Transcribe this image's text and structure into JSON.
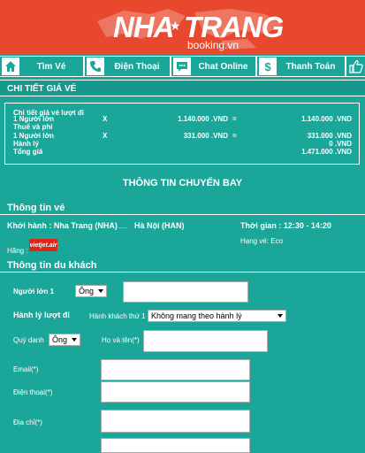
{
  "brand": {
    "part1": "NHA",
    "part2": "TRANG",
    "sub": "booking.vn"
  },
  "nav": [
    {
      "label": "Tìm Vé",
      "icon": "home-icon"
    },
    {
      "label": "Điện Thoại",
      "icon": "phone-icon"
    },
    {
      "label": "Chat Online",
      "icon": "chat-icon"
    },
    {
      "label": "Thanh Toán",
      "icon": "dollar-icon"
    }
  ],
  "price": {
    "section_title": "CHI TIẾT GIÁ VÉ",
    "label_detail": "Chi tiết giá vé lượt đi",
    "row1_label": "1 Người lớn",
    "row1_x": "X",
    "row1_price": "1.140.000 .VND",
    "row1_eq": "=",
    "row1_total": "1.140.000 .VND",
    "tax_label": "Thuế và phí",
    "row2_label": "1 Người lớn",
    "row2_x": "X",
    "row2_price": "331.000 .VND",
    "row2_eq": "=",
    "row2_total": "331.000 .VND",
    "luggage_label": "Hành lý",
    "luggage_value": "0 .VND",
    "total_label": "Tổng giá",
    "total_value": "1.471.000 .VND"
  },
  "flight": {
    "header": "THÔNG TIN CHUYẾN BAY",
    "ticket_title": "Thông tin vé",
    "depart_label": "Khởi hành : Nha Trang (NHA)",
    "arrow": "....",
    "arrive": "Hà Nội (HAN)",
    "time": "Thời gian : 12:30 - 14:20",
    "airline_label": "Hãng :",
    "airline_logo": "vietjet.air",
    "class": "Hạng vé: Eco"
  },
  "passenger": {
    "title": "Thông tin du khách",
    "adult_label": "Người lớn 1",
    "adult_title_value": "Ông",
    "luggage_label": "Hành lý lượt đi",
    "pax_label": "Hành khách thứ 1",
    "luggage_option": "Không mang theo hành lý",
    "contact_title_label": "Quý danh",
    "contact_title_value": "Ông",
    "fullname_label": "Họ và tên(*)",
    "email_label": "Email(*)",
    "phone_label": "Điện thoại(*)",
    "address_label": "Địa chỉ(*)"
  }
}
